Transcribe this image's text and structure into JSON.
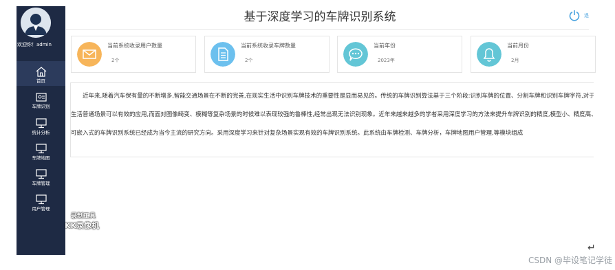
{
  "app": {
    "title": "基于深度学习的车牌识别系统",
    "welcome": "欢迎你！admin"
  },
  "sidebar": {
    "items": [
      {
        "label": "首页",
        "icon": "home-icon"
      },
      {
        "label": "车牌识别",
        "icon": "id-card-icon"
      },
      {
        "label": "统计分析",
        "icon": "monitor-icon"
      },
      {
        "label": "车牌地图",
        "icon": "monitor-icon"
      },
      {
        "label": "车牌管理",
        "icon": "monitor-icon"
      },
      {
        "label": "用户管理",
        "icon": "monitor-icon"
      }
    ]
  },
  "header": {
    "power_icon": "power-icon",
    "power_extra": "退"
  },
  "cards": [
    {
      "title": "当前系统收录用户数量",
      "value": "2个",
      "icon": "mail-icon",
      "color": "#f7b55a"
    },
    {
      "title": "当前系统收录车牌数量",
      "value": "2个",
      "icon": "document-icon",
      "color": "#6cc0ee"
    },
    {
      "title": "当前年份",
      "value": "2023年",
      "icon": "chat-icon",
      "color": "#63c6d6"
    },
    {
      "title": "当前月份",
      "value": "2月",
      "icon": "bell-icon",
      "color": "#63c6d6"
    }
  ],
  "content": {
    "paragraph": "近年来,随着汽车保有量的不断增多,智能交通场景在不断的完善,在现实生活中识别车牌技术的重要性是显而易见的。传统的车牌识别算法基于三个阶段:识别车牌的位置、分割车牌和识别车牌字符,对于生活普通场景可以有效的应用,而面对图像畸变、模糊等复杂场景的时候难以表现较强的鲁棒性,经常出现无法识别现象。近年来越来越多的学者采用深度学习的方法来提升车牌识别的精度,模型小、精度高、可嵌入式的车牌识别系统已经成为当今主流的研究方向。采用深度学习来针对复杂场景实现有效的车牌识别系统。此系统由车牌检测、车牌分析，车牌地图用户管理,等模块组成"
  },
  "overlay": {
    "watermark_line1": "录制工具",
    "watermark_line2": "KK录像机",
    "csdn": "CSDN @毕设笔记学徒"
  },
  "colors": {
    "sidebar_bg": "#1e2a44",
    "sidebar_active": "#2c3b5c"
  }
}
